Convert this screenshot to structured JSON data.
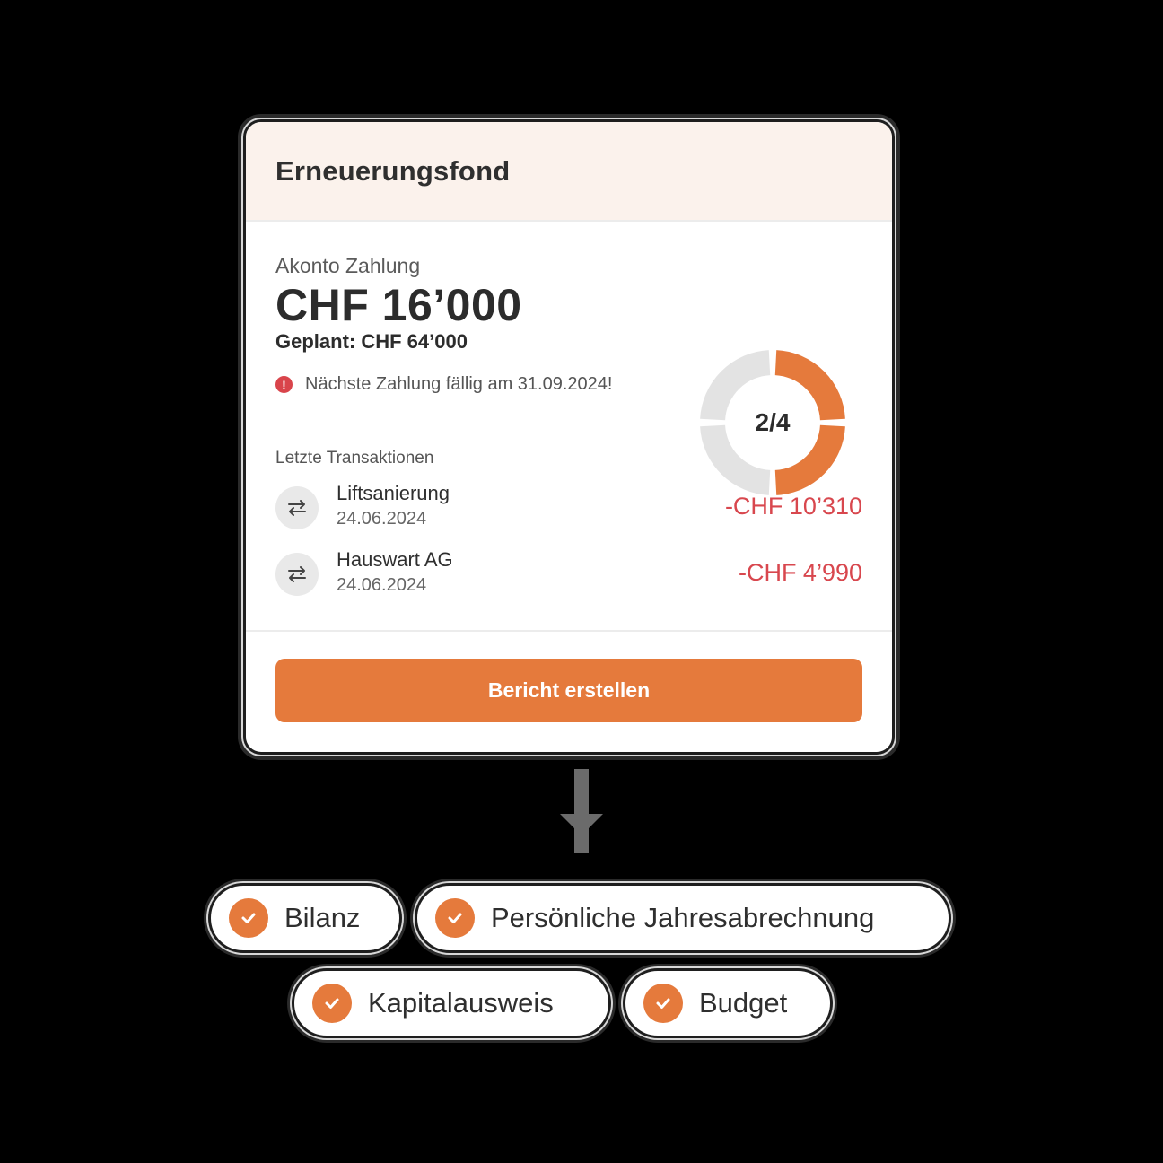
{
  "card": {
    "title": "Erneuerungsfond",
    "subtitle": "Akonto Zahlung",
    "amount": "CHF 16’000",
    "planned": "Geplant: CHF 64’000",
    "alert_icon": "!",
    "alert_text": "Nächste Zahlung fällig am 31.09.2024!",
    "progress": {
      "label": "2/4",
      "completed": 2,
      "total": 4
    },
    "transactions_heading": "Letzte Transaktionen",
    "transactions": [
      {
        "name": "Liftsanierung",
        "date": "24.06.2024",
        "amount": "-CHF 10’310",
        "icon": "transfer-arrows-icon"
      },
      {
        "name": "Hauswart AG",
        "date": "24.06.2024",
        "amount": "-CHF 4’990",
        "icon": "transfer-arrows-icon"
      }
    ],
    "button_label": "Bericht erstellen"
  },
  "outputs": [
    {
      "label": "Bilanz",
      "icon": "check-icon"
    },
    {
      "label": "Persönliche Jahresabrechnung",
      "icon": "check-icon"
    },
    {
      "label": "Kapitalausweis",
      "icon": "check-icon"
    },
    {
      "label": "Budget",
      "icon": "check-icon"
    }
  ],
  "colors": {
    "accent": "#e57a3c",
    "negative": "#d8474e",
    "header_bg": "#fbf2ec",
    "track": "#e3e3e3"
  }
}
